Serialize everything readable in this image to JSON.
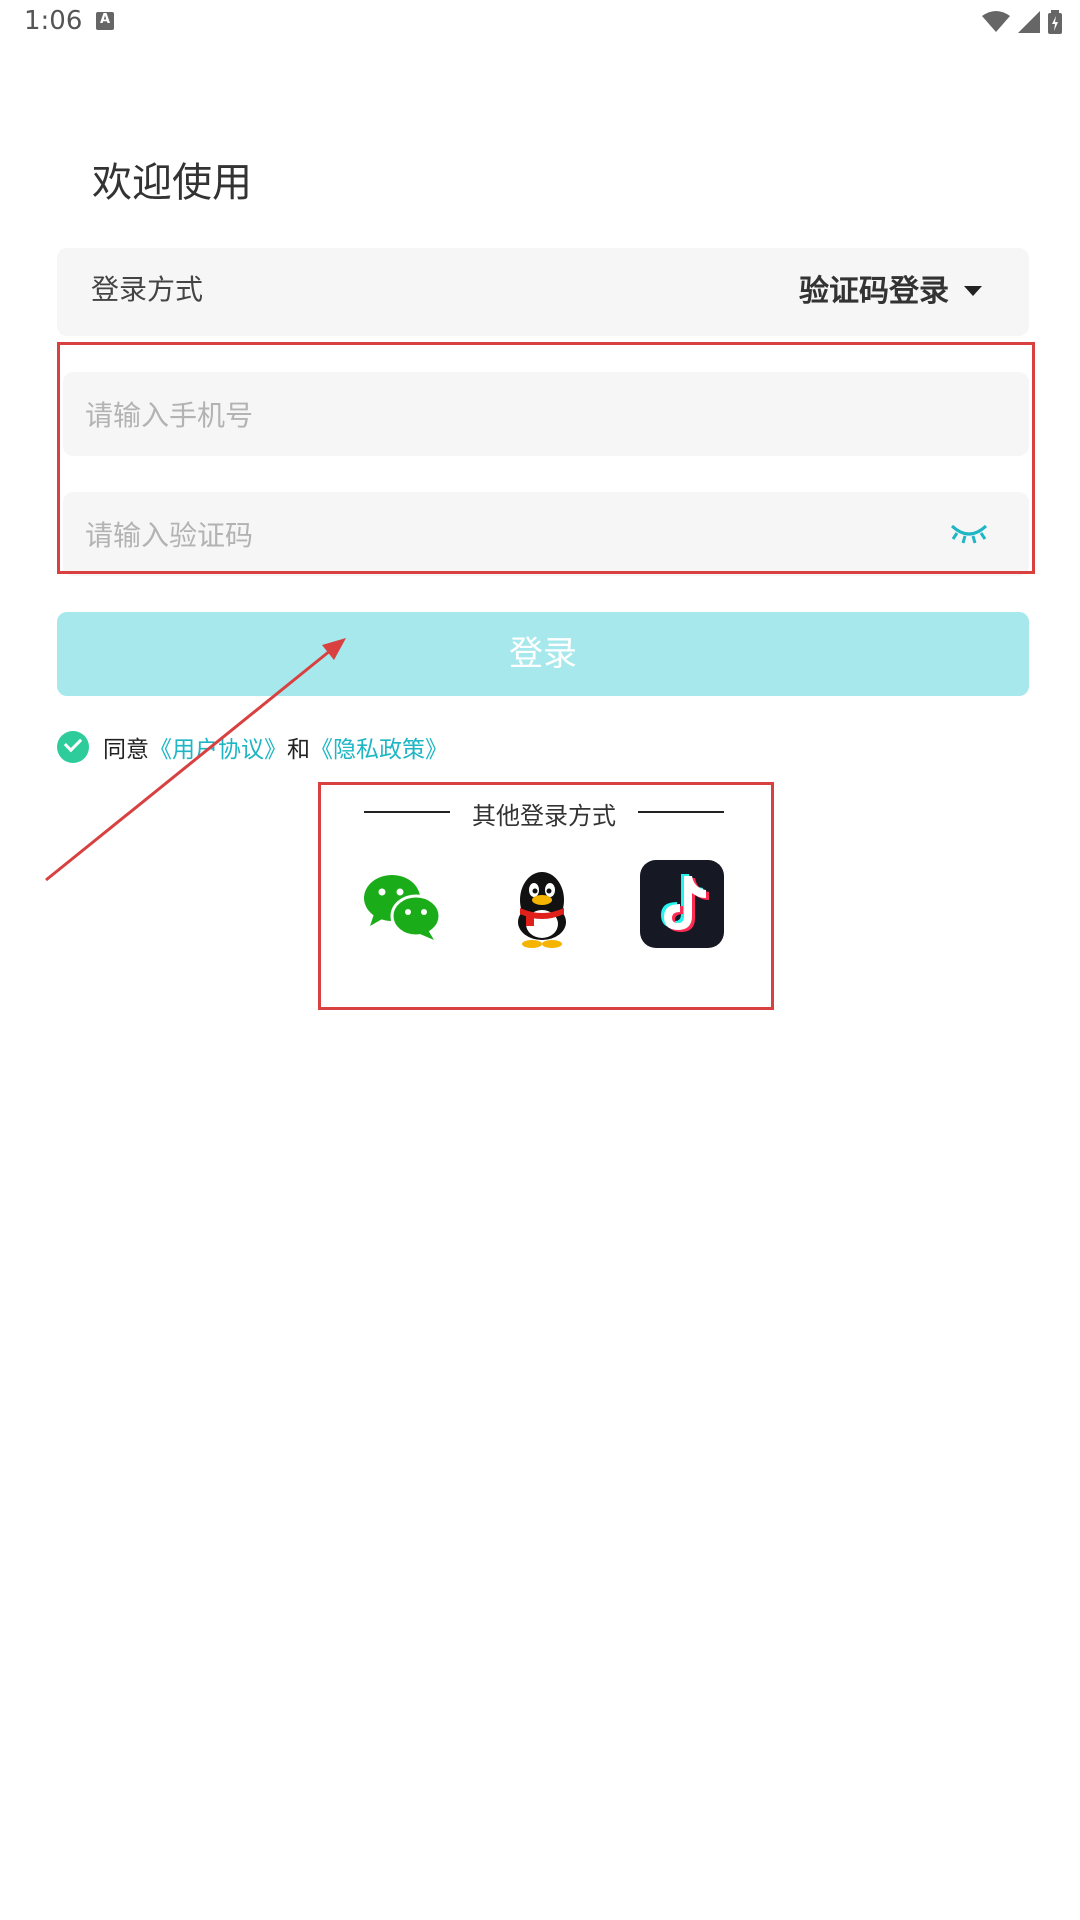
{
  "status_bar": {
    "time": "1:06"
  },
  "title": "欢迎使用",
  "login_method": {
    "label": "登录方式",
    "value": "验证码登录"
  },
  "phone_input": {
    "placeholder": "请输入手机号"
  },
  "code_input": {
    "placeholder": "请输入验证码"
  },
  "login_button": "登录",
  "agreement": {
    "prefix": "同意",
    "user_agreement": "《用户协议》",
    "and": "和",
    "privacy_policy": "《隐私政策》"
  },
  "other_login": {
    "title": "其他登录方式",
    "icons": [
      "wechat-icon",
      "qq-icon",
      "douyin-icon"
    ]
  },
  "colors": {
    "accent": "#1fb6c4",
    "button_disabled": "#a6e8ec",
    "check": "#2ecc9b",
    "annotation": "#d94040"
  }
}
